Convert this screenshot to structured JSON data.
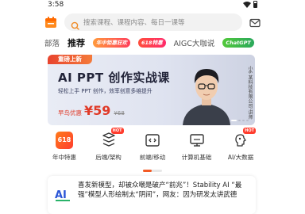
{
  "status_bar": {
    "time": "3:58"
  },
  "search": {
    "placeholder": "搜索课程、课程内容、每日一课等"
  },
  "tabs": {
    "items": [
      "部落",
      "推荐",
      "AIGC大咖说"
    ],
    "active": "推荐",
    "badges": [
      "年中钜惠狂欢",
      "618特惠",
      "ChatGPT"
    ]
  },
  "banner": {
    "ribbon": "重磅上新",
    "title": "AI PPT 创作实战课",
    "subtitle": "轻松上手 PPT 创作，效率创意多维提升",
    "price_label": "早鸟优惠",
    "price": "¥59",
    "old_price": "¥68",
    "vertical_text": "小6 某科技有限公司·讲师",
    "slide_index": 1,
    "slide_count": 4
  },
  "categories": [
    {
      "label": "年中特惠",
      "icon": "618-icon",
      "icon_text": "618"
    },
    {
      "label": "后端/架构",
      "icon": "server-icon",
      "hot": "HOT"
    },
    {
      "label": "前端/移动",
      "icon": "code-icon"
    },
    {
      "label": "计算机基础",
      "icon": "computer-icon"
    },
    {
      "label": "AI/大数据",
      "icon": "ai-brain-icon",
      "hot": "HOT"
    }
  ],
  "news": {
    "text": "喜发新模型，却被众嘲是破产“前兆”！Stability AI “最强”模型人形绘制太“阴间”，网友：因为研发太讲武德"
  },
  "colors": {
    "accent": "#f35a24",
    "price": "#e03a28"
  }
}
